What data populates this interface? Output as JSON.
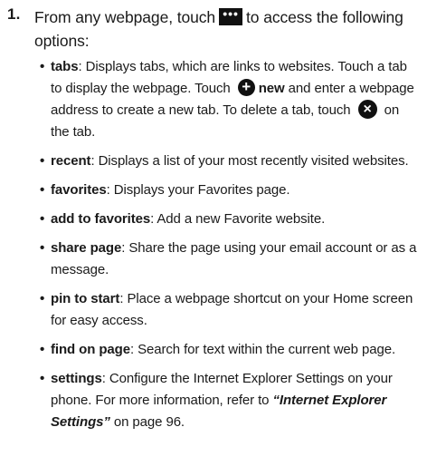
{
  "step": {
    "number": "1.",
    "text_before_icon": "From any webpage, touch",
    "icon": "more-options-icon",
    "icon_glyph": "•••",
    "text_after_icon": "to access the following options:"
  },
  "options": [
    {
      "term": "tabs",
      "desc_1": ": Displays tabs, which are links to websites. Touch a tab to display the webpage. Touch",
      "new_icon": "add-circle-icon",
      "new_icon_glyph": "+",
      "new_label": "new",
      "desc_2": "and enter a webpage address to create a new tab. To delete a tab, touch",
      "close_icon": "close-circle-icon",
      "close_icon_glyph": "×",
      "desc_3": "on the tab."
    },
    {
      "term": "recent",
      "desc": ": Displays a list of your most recently visited websites."
    },
    {
      "term": "favorites",
      "desc": ": Displays your Favorites page."
    },
    {
      "term": "add to favorites",
      "desc": ": Add a new Favorite website."
    },
    {
      "term": "share page",
      "desc": ": Share the page using your email account or as a message."
    },
    {
      "term": "pin to start",
      "desc": ": Place a webpage shortcut on your Home screen for easy access."
    },
    {
      "term": "find on page",
      "desc": ": Search for text within the current web page."
    },
    {
      "term": "settings",
      "desc_1": ": Configure the Internet Explorer Settings on your phone. For more information, refer to",
      "ref": "“Internet Explorer Settings”",
      "desc_2": "on page 96."
    }
  ]
}
